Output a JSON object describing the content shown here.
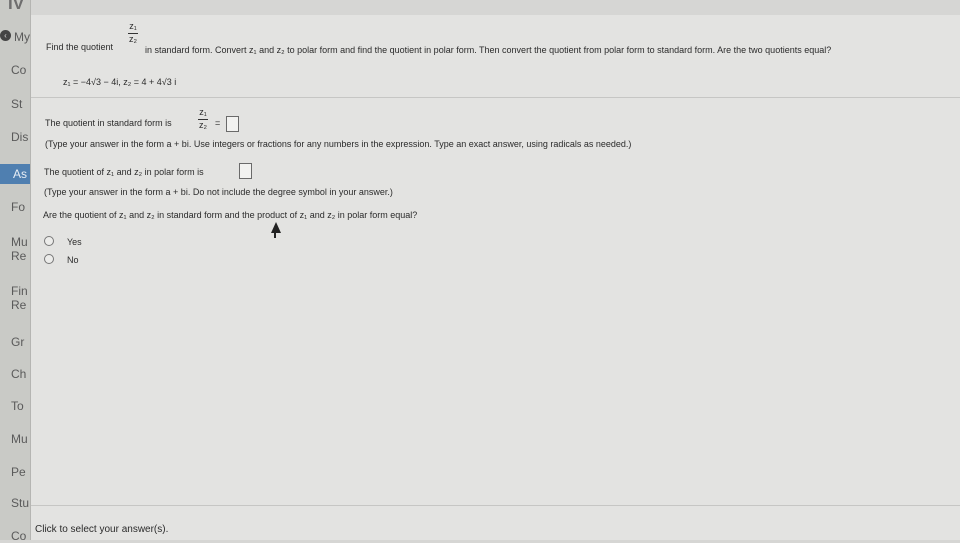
{
  "sidebar": {
    "top_mark": "IV",
    "back_label": "My",
    "items": [
      {
        "label": "Co"
      },
      {
        "label": "St"
      },
      {
        "label": "Dis"
      },
      {
        "label": "As"
      },
      {
        "label": "Fo"
      },
      {
        "label": "Mu"
      },
      {
        "label": "Re"
      },
      {
        "label": "Fin"
      },
      {
        "label": "Re"
      },
      {
        "label": "Gr"
      },
      {
        "label": "Ch"
      },
      {
        "label": "To"
      },
      {
        "label": "Mu"
      },
      {
        "label": "Pe"
      },
      {
        "label": "Stu"
      },
      {
        "label": "Co"
      }
    ]
  },
  "question": {
    "prompt_before": "Find the quotient",
    "fraction_num": "z₁",
    "fraction_den": "z₂",
    "prompt_after": "in standard form. Convert z₁ and z₂ to polar form and find the quotient in polar form. Then convert the quotient from polar form to standard form. Are the two quotients equal?",
    "given": "z₁ = −4√3 − 4i, z₂ = 4 + 4√3 i"
  },
  "parts": {
    "standard_label": "The quotient in standard form is",
    "standard_eq": "=",
    "standard_hint": "(Type your answer in the form a + bi. Use integers or fractions for any numbers in the expression. Type an exact answer, using radicals as needed.)",
    "polar_label": "The quotient of z₁ and z₂ in polar form is",
    "polar_hint": "(Type your answer in the form a + bi. Do not include the degree symbol in your answer.)",
    "equal_question": "Are the quotient of z₁ and z₂ in standard form and the product of z₁ and z₂ in polar form equal?",
    "options": [
      {
        "label": "Yes"
      },
      {
        "label": "No"
      }
    ]
  },
  "footer": {
    "status": "Click to select your answer(s)."
  }
}
